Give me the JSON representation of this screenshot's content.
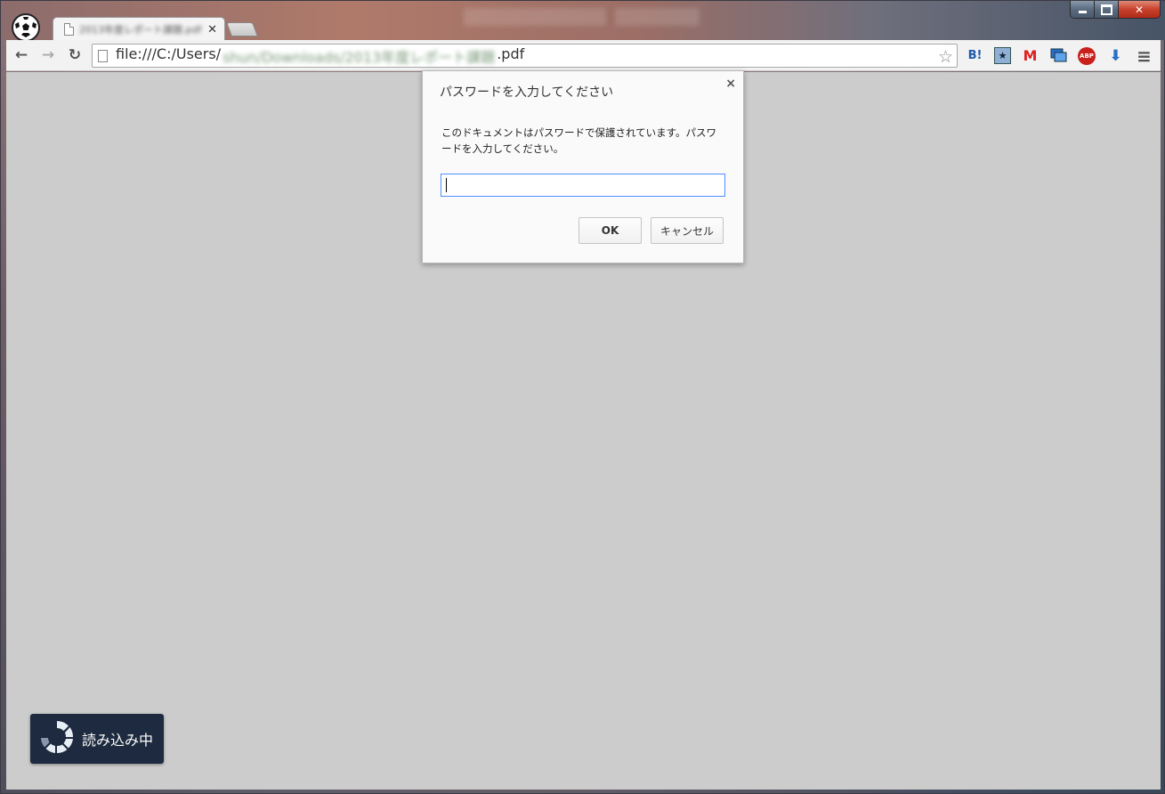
{
  "window": {
    "tab_title": "2013年度レポート課題.pdf",
    "controls": {
      "minimize": "",
      "maximize": "",
      "close": "✕"
    }
  },
  "toolbar": {
    "url_prefix": "file:///C:/Users/",
    "url_blurred": "shun/Downloads/2013年度レポート課題",
    "url_suffix": ".pdf"
  },
  "extensions": [
    {
      "name": "hatena-bookmark-icon",
      "label": "B!"
    },
    {
      "name": "bookmark-star-extension-icon",
      "label": "★"
    },
    {
      "name": "gmail-icon",
      "label": "M"
    },
    {
      "name": "screen-capture-icon",
      "label": ""
    },
    {
      "name": "adblock-plus-icon",
      "label": "ABP"
    },
    {
      "name": "download-icon",
      "label": "⬇"
    },
    {
      "name": "menu-icon",
      "label": "≡"
    }
  ],
  "dialog": {
    "title": "パスワードを入力してください",
    "close": "×",
    "message": "このドキュメントはパスワードで保護されています。パスワードを入力してください。",
    "input_value": "",
    "ok_label": "OK",
    "cancel_label": "キャンセル"
  },
  "loading": {
    "label": "読み込み中"
  },
  "colors": {
    "content_bg": "#cccccc",
    "loading_bg": "#1d2a3f",
    "input_focus": "#4d90fe"
  }
}
